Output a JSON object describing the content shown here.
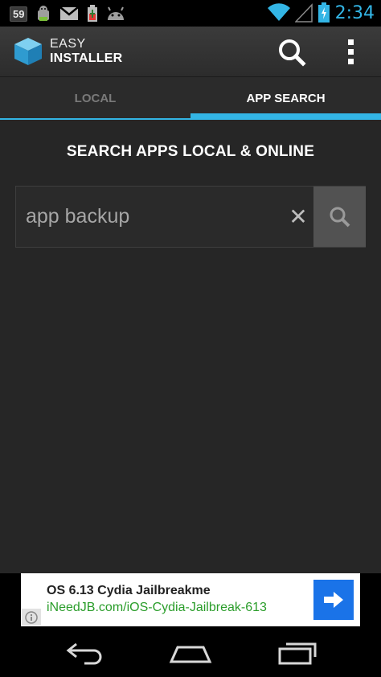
{
  "status_bar": {
    "notification_badge": "59",
    "time": "2:34",
    "icons": [
      "android-debug-icon",
      "gmail-icon",
      "battery-charging-icon",
      "android-icon",
      "wifi-icon",
      "signal-icon",
      "battery-icon"
    ]
  },
  "action_bar": {
    "title_line1": "EASY",
    "title_line2": "INSTALLER",
    "icons": [
      "app-logo-cube-icon",
      "search-icon",
      "overflow-menu-icon"
    ]
  },
  "tabs": [
    {
      "label": "LOCAL",
      "selected": false
    },
    {
      "label": "APP SEARCH",
      "selected": true
    }
  ],
  "main": {
    "heading": "SEARCH APPS LOCAL & ONLINE",
    "search": {
      "value": "app backup",
      "clear_glyph": "✕"
    }
  },
  "ad": {
    "title": "OS 6.13 Cydia Jailbreakme",
    "url": "iNeedJB.com/iOS-Cydia-Jailbreak-613",
    "icons": [
      "info-icon",
      "arrow-right-icon"
    ]
  },
  "navigation_bar": {
    "icons": [
      "back-icon",
      "home-icon",
      "recents-icon"
    ]
  },
  "colors": {
    "accent": "#33b5e5",
    "background": "#262626",
    "ad_link": "#2a9d2a",
    "ad_button": "#1a73e8"
  }
}
